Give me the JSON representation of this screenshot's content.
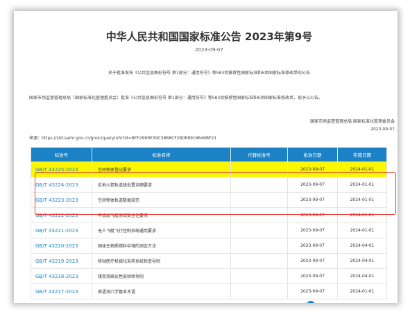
{
  "title": "中华人民共和国国家标准公告 2023年第9号",
  "date": "2023-09-07",
  "intro": "关于批准发布《公共信息图形符号 第1部分：通用符号》等583项推荐性国家标准和6项国家标准修改单的公告",
  "body": "国家市场监督管理总局（国家标准化管理委员会）批准《公共信息图形符号 第1部分：通用符号》等583项推荐性国家标准和6项国家标准修改单，现予以公告。",
  "signature": "国家市场监督管理总局 国家标准化管理委员会",
  "signature_date": "2023-09-07",
  "source": "来源：https://std.samr.gov.cn/gnoc/queryInfo?id=BFF2969E39C386BCF2B0E8918649BF21",
  "table": {
    "headers": [
      "标准号",
      "标准名称",
      "代替标准号",
      "批准日期",
      "实施日期"
    ],
    "rows": [
      {
        "code": "GB/T 43225-2023",
        "name": "空间物体登记要求",
        "replace": "",
        "approve": "2023-09-07",
        "impl": "2024-01-01"
      },
      {
        "code": "GB/T 43224-2023",
        "name": "近地火箭轨道级处置详细要求",
        "replace": "",
        "approve": "2023-09-07",
        "impl": "2024-01-01"
      },
      {
        "code": "GB/T 43223-2023",
        "name": "空间物体轨道数据规范",
        "replace": "",
        "approve": "2023-09-07",
        "impl": "2024-01-01"
      },
      {
        "code": "GB/T 43222-2023",
        "name": "平流层飞艇测试安全性要求",
        "replace": "",
        "approve": "2023-09-07",
        "impl": "2024-01-01"
      },
      {
        "code": "GB/T 43221-2023",
        "name": "无人飞艇飞行控制系统通用要求",
        "replace": "",
        "approve": "2023-09-07",
        "impl": "2024-01-01"
      },
      {
        "code": "GB/T 43220-2023",
        "name": "固体生物质燃料中铼的测定方法",
        "replace": "",
        "approve": "2023-09-07",
        "impl": "2024-04-01"
      },
      {
        "code": "GB/T 43219-2023",
        "name": "移动医疗机械化采样系统检查导则",
        "replace": "",
        "approve": "2023-09-07",
        "impl": "2024-04-01"
      },
      {
        "code": "GB/T 43218-2023",
        "name": "煤炭测硫仪性能验收导则",
        "replace": "",
        "approve": "2023-09-07",
        "impl": "2024-04-01"
      },
      {
        "code": "GB/T 43217-2023",
        "name": "南语洞穴学基本术语",
        "replace": "",
        "approve": "2023-09-07",
        "impl": "2024-01-01"
      }
    ]
  },
  "colors": {
    "header_bg": "#1b82c5",
    "highlight": "#fbf700",
    "callout_border": "#e53935",
    "link": "#1b82c5"
  }
}
